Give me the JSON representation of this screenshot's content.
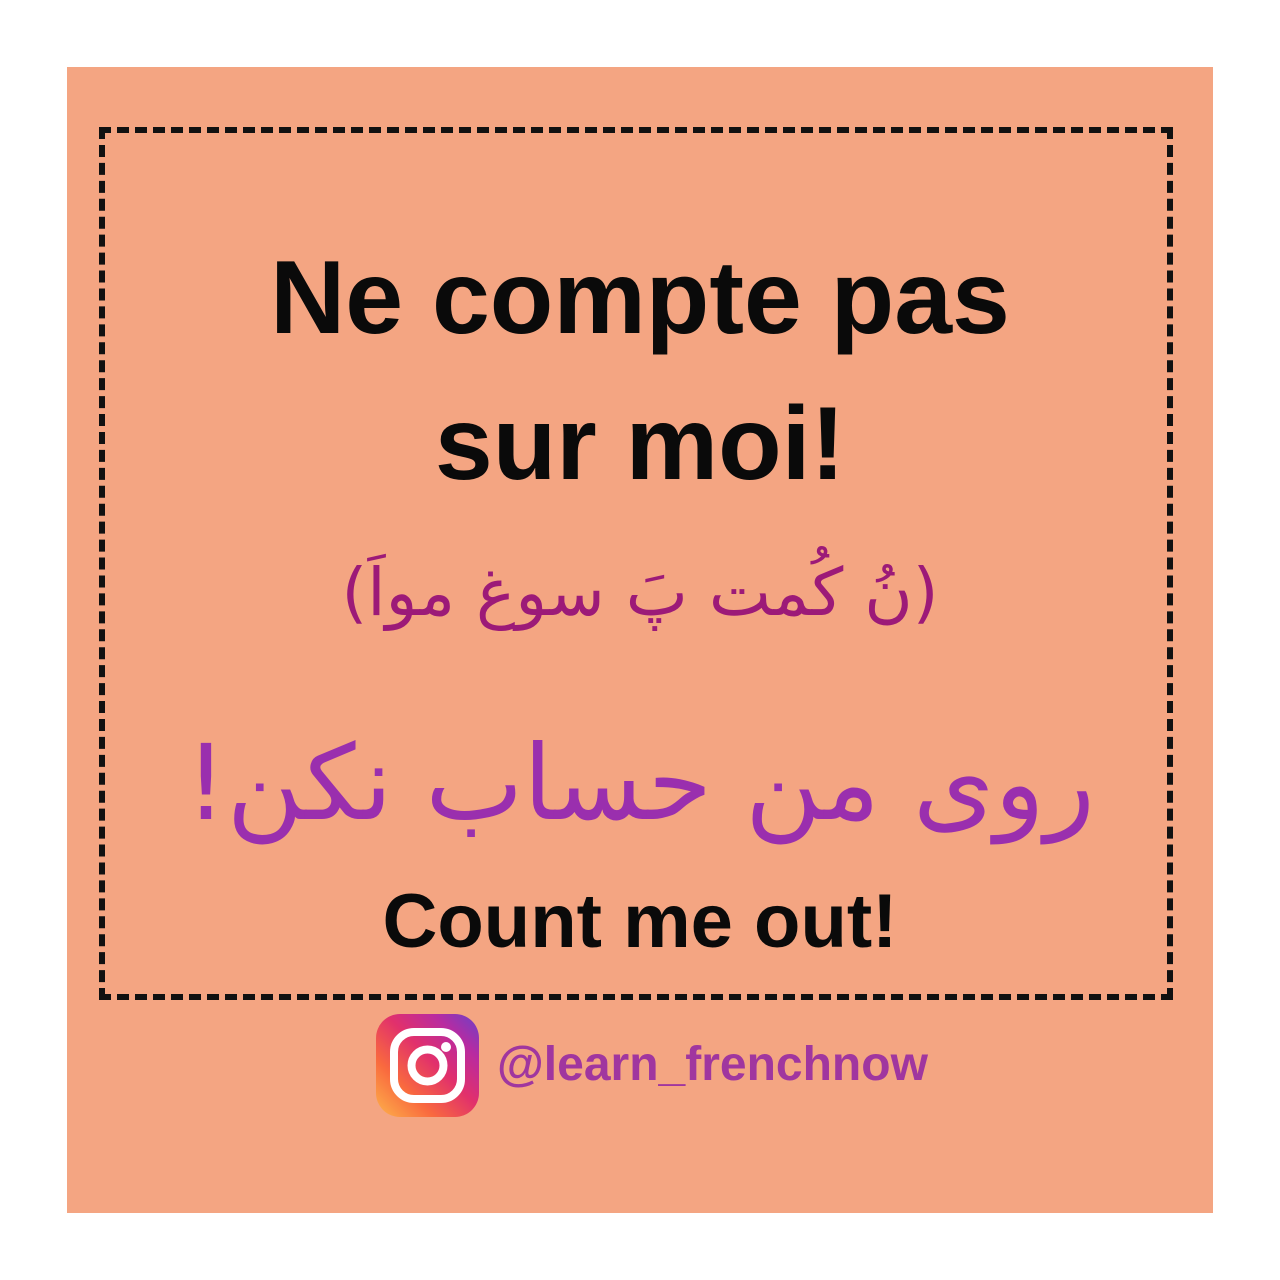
{
  "card": {
    "french_line1": "Ne compte pas",
    "french_line2": "sur moi!",
    "pronunciation": "(نُ کُمت پَ سوغ مواَ)",
    "persian": "روی من حساب نکن!",
    "english": "Count me out!",
    "handle": "@learn_frenchnow",
    "handle_icon": "instagram-icon"
  },
  "colors": {
    "background": "#f4a582",
    "border": "#111111",
    "main_text": "#0a0a0a",
    "pronunciation_text": "#9c1a78",
    "persian_text": "#9a2fae",
    "handle_text": "#a0369f"
  }
}
